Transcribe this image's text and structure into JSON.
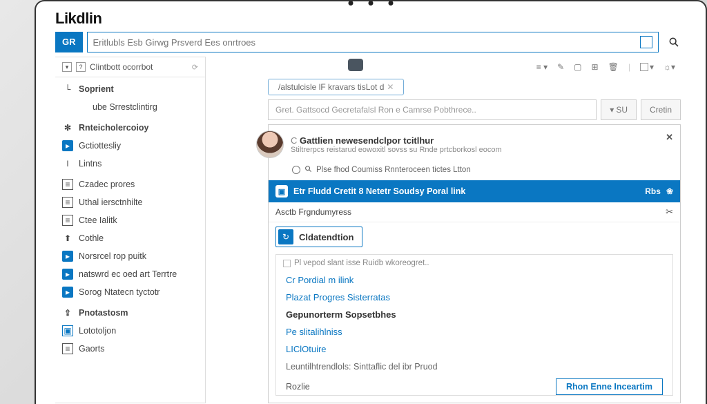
{
  "logo": "Likdlin",
  "search": {
    "badge": "GR",
    "placeholder": "Eritlubls Esb Girwg Prsverd Ees onrtroes"
  },
  "sidebar": {
    "title": "Clintbott ocorrbot",
    "sections": [
      {
        "icon": "dash",
        "label": "Soprient",
        "bold": true
      },
      {
        "icon": "none",
        "label": "ube Srrestclintirg",
        "indent": true
      },
      {
        "icon": "dot",
        "label": "Rnteicholercoioy",
        "bold": true
      },
      {
        "icon": "fill-blue",
        "label": "Gctiottesliy"
      },
      {
        "icon": "l",
        "label": "Lintns"
      },
      {
        "icon": "box",
        "label": "Czadec prores"
      },
      {
        "icon": "box",
        "label": "Uthal iersctnhilte"
      },
      {
        "icon": "box",
        "label": "Ctee Ialitk"
      },
      {
        "icon": "arrow",
        "label": "Cothle"
      },
      {
        "icon": "fill-blue",
        "label": "Norsrcel rop puitk"
      },
      {
        "icon": "fill-blue",
        "label": "natswrd ec oed art Terrtre"
      },
      {
        "icon": "fill-blue",
        "label": "Sorog Ntatecn tyctotr"
      },
      {
        "icon": "share",
        "label": "Pnotastosm",
        "bold": true
      },
      {
        "icon": "box-blue",
        "label": "Lototoljon"
      },
      {
        "icon": "box",
        "label": "Gaorts"
      }
    ]
  },
  "main": {
    "chip": "/alstulcisle lF kravars tisLot d",
    "placeholder2": "Gret. Gattsocd Gecretafalsl Ron e Camrse Pobthrece..",
    "su_btn": "SU",
    "cretin_btn": "Cretin",
    "person": {
      "name": "Gattlien newesendclpor tcitlhur",
      "sub": "Stiltrerpcs reistarud eowoxitl sovss su Rnde prtcborkosl eocom"
    },
    "micro": "Plse fhod Coumiss Rnnteroceen tictes Ltton",
    "bluebar": {
      "label": "Etr Fludd Cretit 8 Netetr Soudsy Poral link",
      "action": "Rbs"
    },
    "subrow": "Asctb Frgndumyress",
    "tab": "Cldatendtion",
    "inner_title": "Pl vepod slant isse Ruidb wkoreogret..",
    "items": [
      {
        "text": "Cr Pordial m ilink",
        "style": "link"
      },
      {
        "text": "Plazat Progres Sisterratas",
        "style": "link"
      },
      {
        "text": "Gepunorterm Sopsetbhes",
        "style": "bold"
      },
      {
        "text": "Pe slitalihlniss",
        "style": "link"
      },
      {
        "text": "LIClOtuire",
        "style": "link"
      }
    ],
    "desc": "Leuntilhtrendlols: Sinttaflic del ibr Pruod",
    "bottom_left": "Rozlie",
    "bottom_btn": "Rhon Enne Inceartim"
  }
}
